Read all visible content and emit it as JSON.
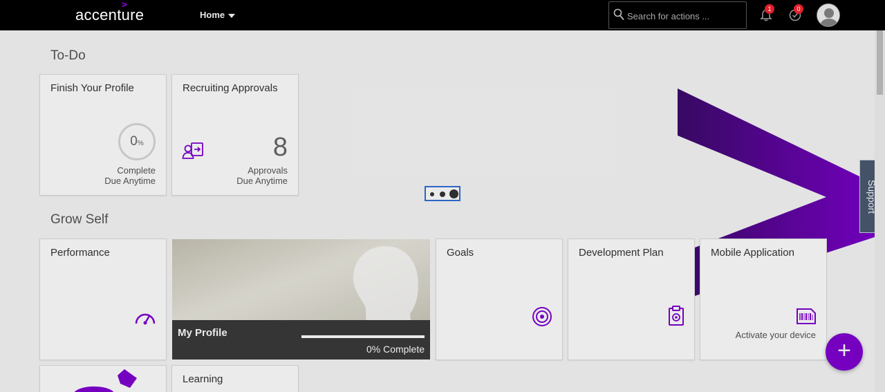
{
  "header": {
    "logo_text": "accenture",
    "logo_mark": ">",
    "home_menu_label": "Home",
    "search_placeholder": "Search for actions ...",
    "notifications_badge": "1",
    "approvals_badge": "0"
  },
  "todo": {
    "section_title": "To-Do",
    "finish_profile": {
      "title": "Finish Your Profile",
      "percent": "0",
      "percent_unit": "%",
      "status": "Complete",
      "due": "Due Anytime"
    },
    "recruiting": {
      "title": "Recruiting Approvals",
      "count": "8",
      "label": "Approvals",
      "due": "Due Anytime"
    }
  },
  "grow_self": {
    "section_title": "Grow Self",
    "performance_title": "Performance",
    "my_profile": {
      "name": "My Profile",
      "progress_fraction": 0,
      "progress_text": "0% Complete"
    },
    "goals_title": "Goals",
    "development_plan_title": "Development Plan",
    "mobile_app": {
      "title": "Mobile Application",
      "caption": "Activate your device"
    },
    "learning_title": "Learning"
  },
  "support_label": "Support",
  "fab_label": "+",
  "colors": {
    "accent": "#7f00d1",
    "header": "#000000",
    "support_tab": "#4a5a71",
    "badge": "#e0202b"
  }
}
